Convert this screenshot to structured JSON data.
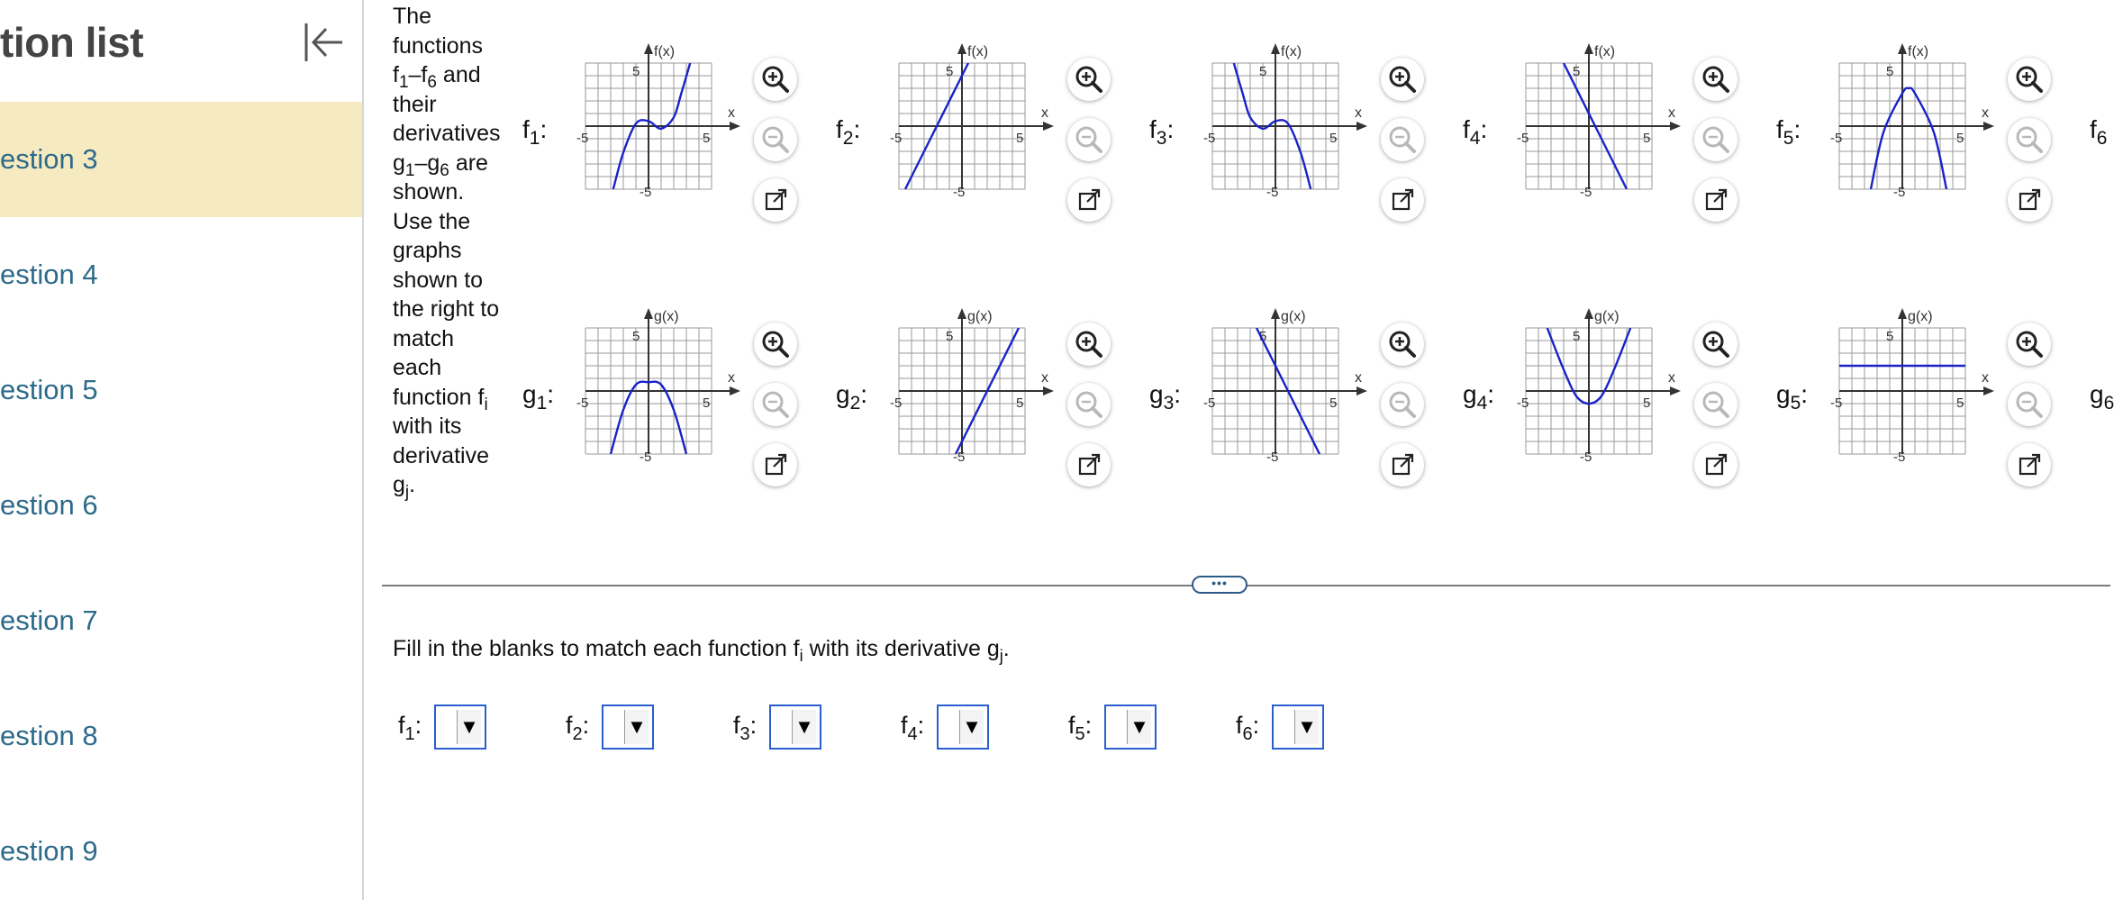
{
  "sidebar": {
    "title": "tion list",
    "items": [
      {
        "label": "estion 3"
      },
      {
        "label": "estion 4"
      },
      {
        "label": "estion 5"
      },
      {
        "label": "estion 6"
      },
      {
        "label": "estion 7"
      },
      {
        "label": "estion 8"
      },
      {
        "label": "estion 9"
      }
    ],
    "active_color": "#f6ebc0",
    "link_color": "#2e6a8a"
  },
  "intro": {
    "w1": "The",
    "w2": "functions",
    "f": "f",
    "s1": "1",
    "dash": "–f",
    "s6": "6",
    "and": " and",
    "w3": "their",
    "w4": "derivatives",
    "g": "g",
    "gs1": "1",
    "gdash": "–g",
    "gs6": "6",
    "are": " are",
    "w5": "shown.",
    "w6": "Use the",
    "w7": "graphs",
    "w8": "shown to",
    "w9": "the right to",
    "w10": "match",
    "w11": "each",
    "w12a": "function f",
    "w12s": "i",
    "w13": "with its",
    "w14": "derivative",
    "w15a": "g",
    "w15s": "j",
    "w15b": "."
  },
  "graph_text": {
    "f_axis": "f(x)",
    "g_axis": "g(x)",
    "x_axis": "x",
    "tick_pos": "5",
    "tick_neg": "-5"
  },
  "f_labels": [
    {
      "letter": "f",
      "sub": "1",
      "colon": ":"
    },
    {
      "letter": "f",
      "sub": "2",
      "colon": ":"
    },
    {
      "letter": "f",
      "sub": "3",
      "colon": ":"
    },
    {
      "letter": "f",
      "sub": "4",
      "colon": ":"
    },
    {
      "letter": "f",
      "sub": "5",
      "colon": ":"
    },
    {
      "letter": "f",
      "sub": "6",
      "colon": ""
    }
  ],
  "g_labels": [
    {
      "letter": "g",
      "sub": "1",
      "colon": ":"
    },
    {
      "letter": "g",
      "sub": "2",
      "colon": ":"
    },
    {
      "letter": "g",
      "sub": "3",
      "colon": ":"
    },
    {
      "letter": "g",
      "sub": "4",
      "colon": ":"
    },
    {
      "letter": "g",
      "sub": "5",
      "colon": ":"
    },
    {
      "letter": "g",
      "sub": "6",
      "colon": ""
    }
  ],
  "chart_data": [
    {
      "type": "line",
      "name": "f1",
      "xlim": [
        -5,
        5
      ],
      "ylim": [
        -5,
        5
      ],
      "x": [
        -2.8,
        -2,
        -1,
        0,
        1,
        2,
        2.6,
        3.3
      ],
      "y": [
        -5,
        -2.1,
        0.2,
        0.4,
        -0.2,
        0.7,
        2.6,
        5
      ]
    },
    {
      "type": "line",
      "name": "f2",
      "xlim": [
        -5,
        5
      ],
      "ylim": [
        -5,
        5
      ],
      "x": [
        -4.5,
        0.5
      ],
      "y": [
        -5,
        5
      ]
    },
    {
      "type": "line",
      "name": "f3",
      "xlim": [
        -5,
        5
      ],
      "ylim": [
        -5,
        5
      ],
      "x": [
        -3.3,
        -2.6,
        -2,
        -1,
        0,
        1,
        2,
        2.8
      ],
      "y": [
        5,
        2.6,
        0.7,
        -0.2,
        0.4,
        0.2,
        -2.1,
        -5
      ]
    },
    {
      "type": "line",
      "name": "f4",
      "xlim": [
        -5,
        5
      ],
      "ylim": [
        -5,
        5
      ],
      "x": [
        -2,
        3
      ],
      "y": [
        5,
        -5
      ]
    },
    {
      "type": "line",
      "name": "f5",
      "xlim": [
        -5,
        5
      ],
      "ylim": [
        -5,
        5
      ],
      "x": [
        -2.5,
        -1.5,
        0,
        0.5,
        1,
        2.5,
        3.5
      ],
      "y": [
        -5,
        -0.5,
        2.6,
        3,
        2.6,
        -0.5,
        -5
      ]
    },
    {
      "type": "line",
      "name": "g1",
      "xlim": [
        -5,
        5
      ],
      "ylim": [
        -5,
        5
      ],
      "x": [
        -3,
        -2,
        -1,
        0,
        1,
        2,
        3
      ],
      "y": [
        -5,
        -1.5,
        0.5,
        0.7,
        0.5,
        -1.5,
        -5
      ]
    },
    {
      "type": "line",
      "name": "g2",
      "xlim": [
        -5,
        5
      ],
      "ylim": [
        -5,
        5
      ],
      "x": [
        -0.5,
        4.5
      ],
      "y": [
        -5,
        5
      ]
    },
    {
      "type": "line",
      "name": "g3",
      "xlim": [
        -5,
        5
      ],
      "ylim": [
        -5,
        5
      ],
      "x": [
        -1.5,
        3.5
      ],
      "y": [
        5,
        -5
      ]
    },
    {
      "type": "line",
      "name": "g4",
      "xlim": [
        -5,
        5
      ],
      "ylim": [
        -5,
        5
      ],
      "x": [
        -3.3,
        -2,
        -1,
        0,
        1,
        2,
        3.3
      ],
      "y": [
        5,
        1.7,
        -0.4,
        -1,
        -0.4,
        1.7,
        5
      ]
    },
    {
      "type": "line",
      "name": "g5",
      "xlim": [
        -5,
        5
      ],
      "ylim": [
        -5,
        5
      ],
      "x": [
        -5,
        5
      ],
      "y": [
        2,
        2
      ]
    }
  ],
  "curve_color": "#1a22c8",
  "divider": {
    "handle": "•••"
  },
  "prompt": {
    "a": "Fill in the blanks to match each function f",
    "i": "i",
    "b": " with its derivative g",
    "j": "j",
    "c": "."
  },
  "answers": [
    {
      "letter": "f",
      "sub": "1",
      "colon": ":",
      "value": ""
    },
    {
      "letter": "f",
      "sub": "2",
      "colon": ":",
      "value": ""
    },
    {
      "letter": "f",
      "sub": "3",
      "colon": ":",
      "value": ""
    },
    {
      "letter": "f",
      "sub": "4",
      "colon": ":",
      "value": ""
    },
    {
      "letter": "f",
      "sub": "5",
      "colon": ":",
      "value": ""
    },
    {
      "letter": "f",
      "sub": "6",
      "colon": ":",
      "value": ""
    }
  ],
  "dropdown_arrow": "▼"
}
